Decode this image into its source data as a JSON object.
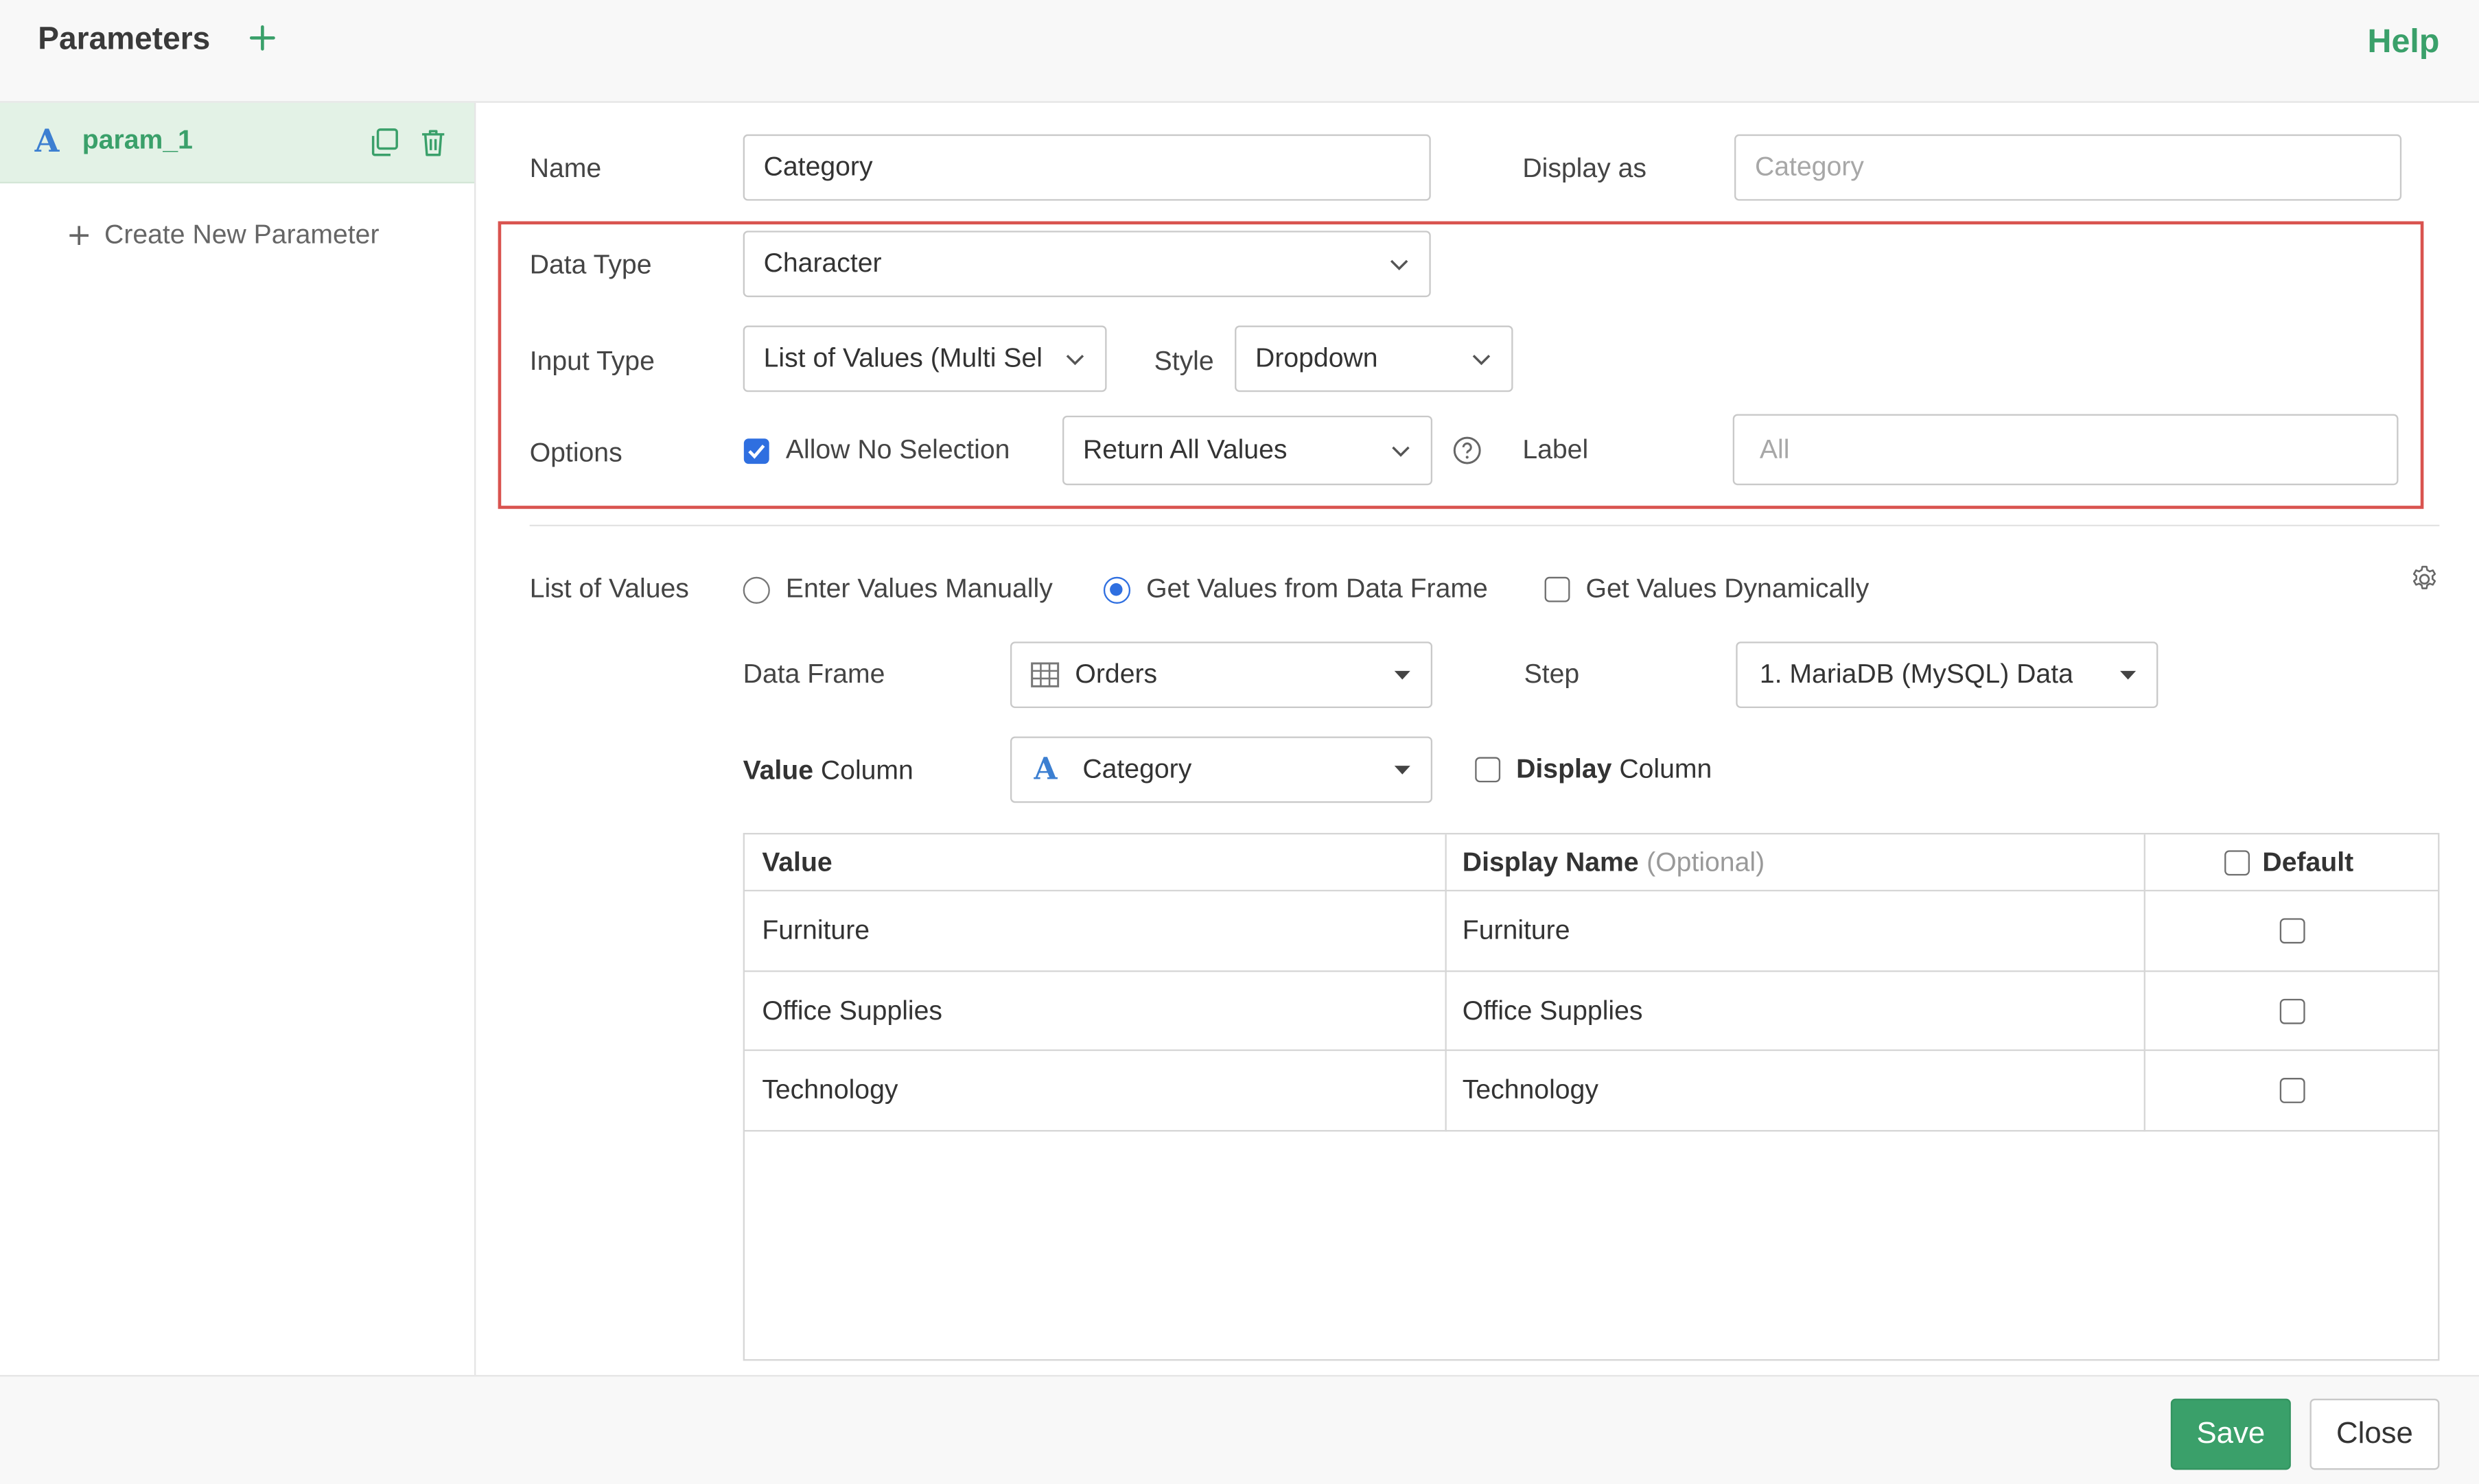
{
  "header": {
    "title": "Parameters",
    "help_label": "Help"
  },
  "sidebar": {
    "parameters": [
      {
        "name": "param_1",
        "type_icon": "A"
      }
    ],
    "create_label": "Create New Parameter"
  },
  "form": {
    "name_label": "Name",
    "name_value": "Category",
    "display_as_label": "Display as",
    "display_as_placeholder": "Category",
    "data_type_label": "Data Type",
    "data_type_value": "Character",
    "input_type_label": "Input Type",
    "input_type_value": "List of Values (Multi Sel",
    "style_label": "Style",
    "style_value": "Dropdown",
    "options_label": "Options",
    "allow_no_selection_label": "Allow No Selection",
    "allow_no_selection_checked": true,
    "no_selection_behavior_value": "Return All Values",
    "label_label": "Label",
    "label_placeholder": "All"
  },
  "list_of_values": {
    "section_label": "List of Values",
    "source_options": [
      {
        "label": "Enter Values Manually",
        "selected": false
      },
      {
        "label": "Get Values from Data Frame",
        "selected": true
      }
    ],
    "dynamic_label": "Get Values Dynamically",
    "dynamic_checked": false,
    "data_frame_label": "Data Frame",
    "data_frame_value": "Orders",
    "step_label": "Step",
    "step_value": "1. MariaDB (MySQL) Data",
    "value_column_label_bold": "Value",
    "value_column_label_rest": " Column",
    "value_column_value": "Category",
    "value_column_type_icon": "A",
    "display_column_label_bold": "Display",
    "display_column_label_rest": " Column",
    "display_column_checked": false,
    "table": {
      "headers": {
        "value": "Value",
        "display_name": "Display Name",
        "display_name_hint": "(Optional)",
        "default": "Default"
      },
      "rows": [
        {
          "value": "Furniture",
          "display_name": "Furniture",
          "default": false
        },
        {
          "value": "Office Supplies",
          "display_name": "Office Supplies",
          "default": false
        },
        {
          "value": "Technology",
          "display_name": "Technology",
          "default": false
        }
      ]
    }
  },
  "footer": {
    "save_label": "Save",
    "close_label": "Close"
  },
  "colors": {
    "accent_green": "#3aa06a",
    "highlight_red": "#d9534f",
    "checkbox_blue": "#2f6fe0",
    "type_icon_blue": "#3c7fd1"
  },
  "icons": [
    "plus-icon",
    "character-type-icon",
    "copy-icon",
    "trash-icon",
    "chevron-down-icon",
    "caret-down-icon",
    "help-circle-icon",
    "gear-icon",
    "table-icon"
  ]
}
